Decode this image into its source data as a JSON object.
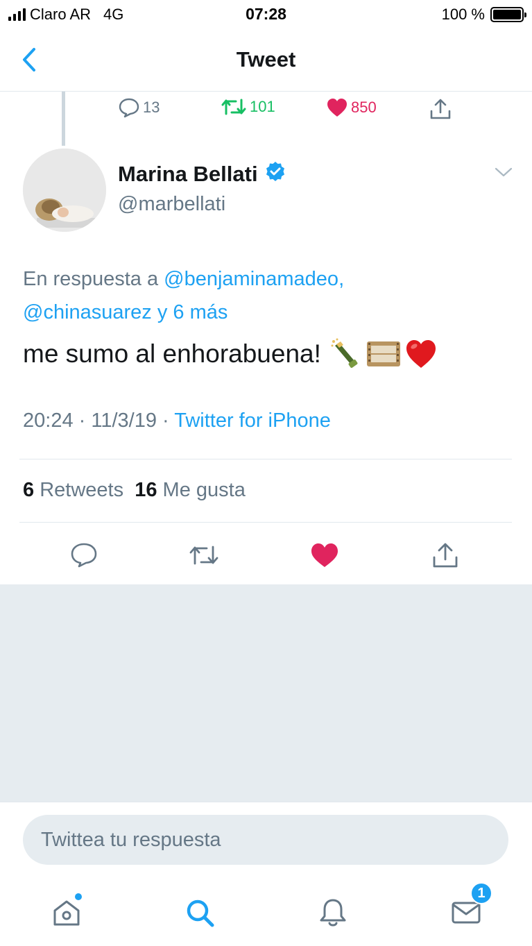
{
  "status_bar": {
    "carrier": "Claro AR",
    "network": "4G",
    "time": "07:28",
    "battery": "100 %",
    "battery_level": 1.0
  },
  "nav": {
    "title": "Tweet",
    "back_icon": "chevron-left-icon"
  },
  "parent_tweet": {
    "replies": "13",
    "retweets": "101",
    "likes": "850"
  },
  "tweet": {
    "display_name": "Marina Bellati",
    "handle": "@marbellati",
    "reply_prefix": "En respuesta a ",
    "reply_user1": "@benjaminamadeo,",
    "reply_user2": "@chinasuarez",
    "reply_more": " y 6 más",
    "text": "me sumo al enhorabuena!",
    "time": "20:24 · 11/3/19 · ",
    "source": "Twitter for iPhone",
    "retweet_count": "6",
    "retweet_label": "Retweets",
    "like_count": "16",
    "like_label": "Me gusta"
  },
  "reply": {
    "placeholder": "Twittea tu respuesta"
  },
  "tabs": {
    "messages_badge": "1"
  },
  "colors": {
    "accent": "#1da1f2",
    "retweet": "#17bf63",
    "like": "#e0245e",
    "secondary_text": "#657786"
  }
}
